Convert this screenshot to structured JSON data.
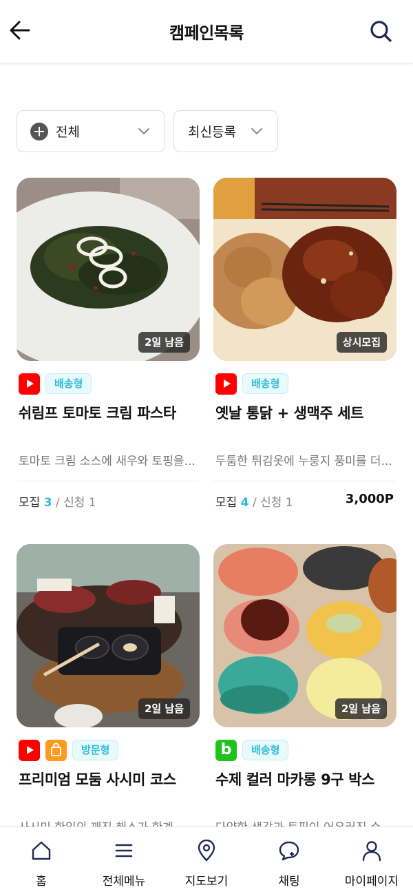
{
  "header": {
    "title": "캠페인목록",
    "back_icon": "back-arrow-icon",
    "search_icon": "search-icon"
  },
  "filters": {
    "category": {
      "label": "전체",
      "icon": "plus-circle-icon"
    },
    "sort": {
      "label": "최신등록"
    }
  },
  "campaigns": [
    {
      "badge": "2일 남음",
      "channels": [
        "youtube"
      ],
      "type": "배송형",
      "name": "쉬림프 토마토 크림 파스타",
      "desc": "토마토 크림 소스에 새우와 토핑을...",
      "recruit_label": "모집",
      "recruit": "3",
      "apply": "/ 신청 1",
      "point": ""
    },
    {
      "badge": "상시모집",
      "channels": [
        "youtube"
      ],
      "type": "배송형",
      "name": "옛날 통닭 + 생맥주 세트",
      "desc": "두툼한 튀김옷에 누룽지 풍미를 더...",
      "recruit_label": "모집",
      "recruit": "4",
      "apply": "/ 신청 1",
      "point": "3,000P"
    },
    {
      "badge": "2일 남음",
      "channels": [
        "youtube",
        "shopping"
      ],
      "type": "방문형",
      "name": "프리미엄 모둠 사시미 코스",
      "desc": "사시미 한입의 깨진 해소가 한계",
      "recruit_label": "",
      "recruit": "",
      "apply": "",
      "point": ""
    },
    {
      "badge": "2일 남음",
      "channels": [
        "blog"
      ],
      "type": "배송형",
      "name": "수제 컬러 마카롱 9구 박스",
      "desc": "다양한 색감과 토핑이 어우러진 수",
      "recruit_label": "",
      "recruit": "",
      "apply": "",
      "point": ""
    }
  ],
  "blog_letter": "b",
  "bottom_nav": [
    {
      "label": "홈",
      "icon": "home-icon"
    },
    {
      "label": "전체메뉴",
      "icon": "menu-icon"
    },
    {
      "label": "지도보기",
      "icon": "map-pin-icon"
    },
    {
      "label": "채팅",
      "icon": "chat-icon"
    },
    {
      "label": "마이페이지",
      "icon": "user-icon"
    }
  ],
  "colors": {
    "accent": "#2dbcd5",
    "youtube": "#ff0000",
    "shopping": "#ff9a1f",
    "blog": "#21c21e"
  }
}
